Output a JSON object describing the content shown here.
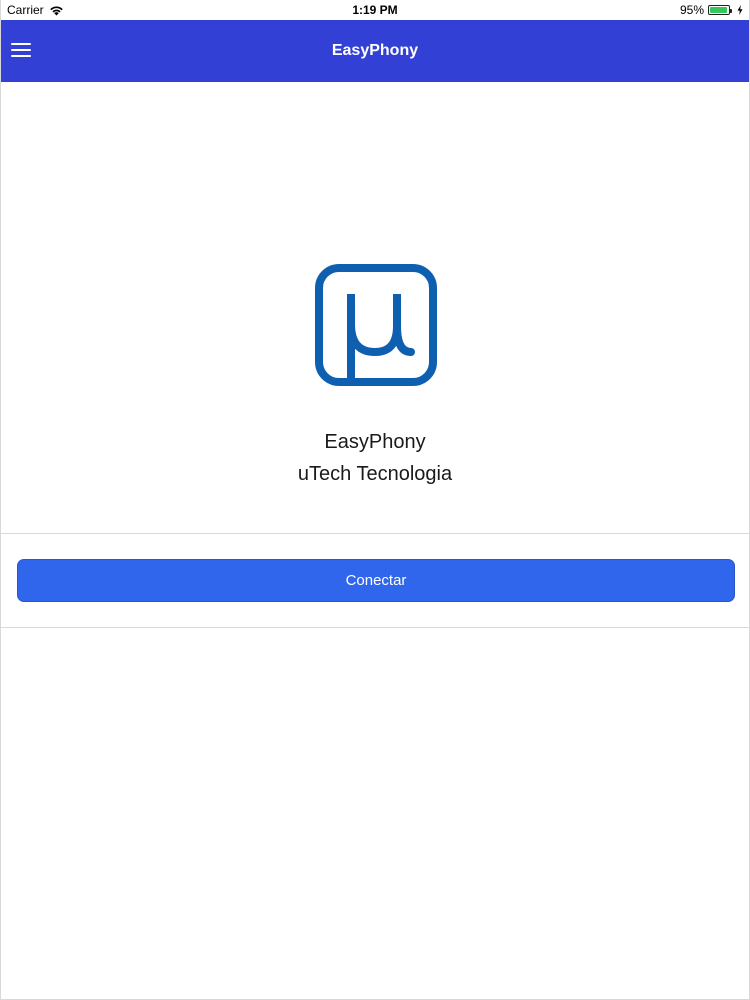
{
  "status_bar": {
    "carrier": "Carrier",
    "time": "1:19 PM",
    "battery_percent": "95%",
    "battery_level": 0.95,
    "icons": [
      "wifi-icon",
      "battery-icon",
      "charging-icon"
    ]
  },
  "nav": {
    "title": "EasyPhony",
    "menu_icon": "hamburger-menu-icon"
  },
  "header": {
    "logo_icon": "utech-mu-logo-icon",
    "app_name": "EasyPhony",
    "company": "uTech Tecnologia"
  },
  "actions": {
    "connect_label": "Conectar"
  },
  "colors": {
    "nav_background": "#3340d6",
    "button_background": "#2f66ec",
    "logo_blue": "#0f5fb1",
    "battery_green": "#34c759"
  }
}
